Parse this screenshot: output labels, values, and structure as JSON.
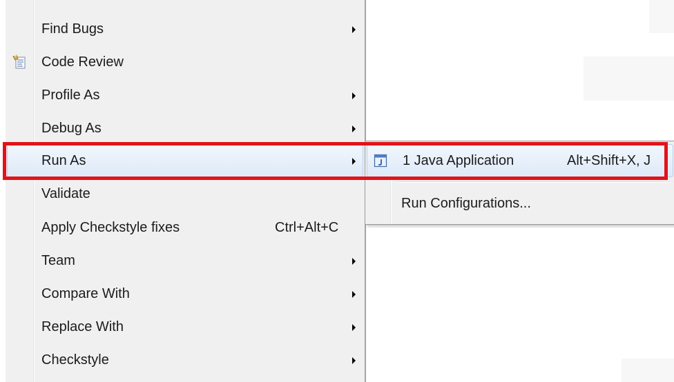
{
  "menu": {
    "items": [
      {
        "label": "Find Bugs",
        "accel": "",
        "submenu": true,
        "icon": ""
      },
      {
        "label": "Code Review",
        "accel": "",
        "submenu": false,
        "icon": "code-review-icon"
      },
      {
        "label": "Profile As",
        "accel": "",
        "submenu": true,
        "icon": ""
      },
      {
        "label": "Debug As",
        "accel": "",
        "submenu": true,
        "icon": ""
      },
      {
        "label": "Run As",
        "accel": "",
        "submenu": true,
        "icon": "",
        "highlighted": true
      },
      {
        "label": "Validate",
        "accel": "",
        "submenu": false,
        "icon": ""
      },
      {
        "label": "Apply Checkstyle fixes",
        "accel": "Ctrl+Alt+C",
        "submenu": false,
        "icon": ""
      },
      {
        "label": "Team",
        "accel": "",
        "submenu": true,
        "icon": ""
      },
      {
        "label": "Compare With",
        "accel": "",
        "submenu": true,
        "icon": ""
      },
      {
        "label": "Replace With",
        "accel": "",
        "submenu": true,
        "icon": ""
      },
      {
        "label": "Checkstyle",
        "accel": "",
        "submenu": true,
        "icon": ""
      }
    ]
  },
  "submenu": {
    "items": [
      {
        "label": "1 Java Application",
        "accel": "Alt+Shift+X, J",
        "icon": "java-application-icon",
        "highlighted": true
      },
      {
        "label": "Run Configurations...",
        "accel": "",
        "icon": ""
      }
    ]
  },
  "colors": {
    "menu_background": "#f0f0f0",
    "highlight": "#dde9f8",
    "annotation_border": "#e3121b"
  }
}
